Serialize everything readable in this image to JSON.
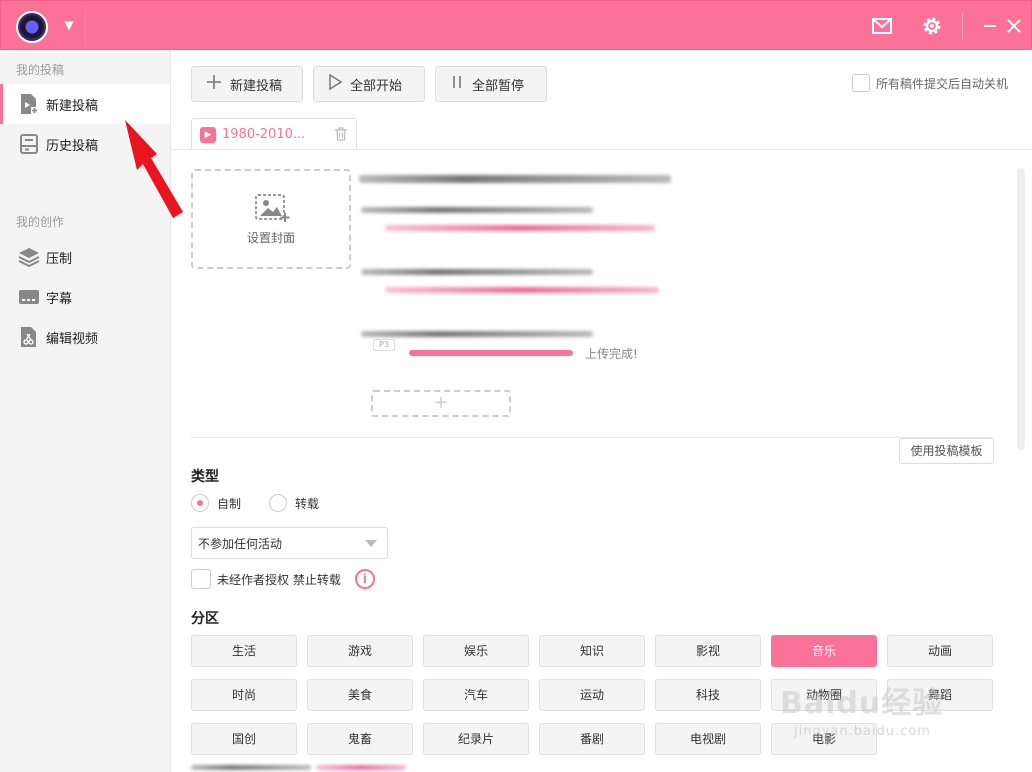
{
  "titlebar": {
    "icons": [
      "avatar",
      "chevron-down-icon",
      "mail-icon",
      "gear-icon",
      "minimize-icon",
      "close-icon"
    ]
  },
  "sidebar": {
    "section1": "我的投稿",
    "section2": "我的创作",
    "items": [
      {
        "label": "新建投稿",
        "icon": "new-post-icon",
        "active": true
      },
      {
        "label": "历史投稿",
        "icon": "history-icon",
        "active": false
      },
      {
        "label": "压制",
        "icon": "layers-icon",
        "active": false
      },
      {
        "label": "字幕",
        "icon": "subtitle-icon",
        "active": false
      },
      {
        "label": "编辑视频",
        "icon": "edit-video-icon",
        "active": false
      }
    ]
  },
  "toolbar": {
    "new_label": "新建投稿",
    "start_all_label": "全部开始",
    "pause_all_label": "全部暂停",
    "auto_shutdown_label": "所有稿件提交后自动关机"
  },
  "file_tab": {
    "name": "1980-2010..."
  },
  "cover": {
    "label": "设置封面"
  },
  "upload": {
    "status": "上传完成!",
    "progress": 1.0
  },
  "template_btn": "使用投稿模板",
  "type": {
    "label": "类型",
    "options": [
      "自制",
      "转载"
    ],
    "selected": "自制"
  },
  "activity_select": {
    "value": "不参加任何活动"
  },
  "forbid": {
    "label": "未经作者授权 禁止转载"
  },
  "category": {
    "label": "分区",
    "items": [
      "生活",
      "游戏",
      "娱乐",
      "知识",
      "影视",
      "音乐",
      "动画",
      "时尚",
      "美食",
      "汽车",
      "运动",
      "科技",
      "动物圈",
      "舞蹈",
      "国创",
      "鬼畜",
      "纪录片",
      "番剧",
      "电视剧",
      "电影"
    ],
    "selected": "音乐"
  },
  "watermark": {
    "logo": "Baidu经验",
    "url": "jingyan.baidu.com"
  },
  "colors": {
    "accent": "#fb7299",
    "annotation": "#e8141e"
  }
}
